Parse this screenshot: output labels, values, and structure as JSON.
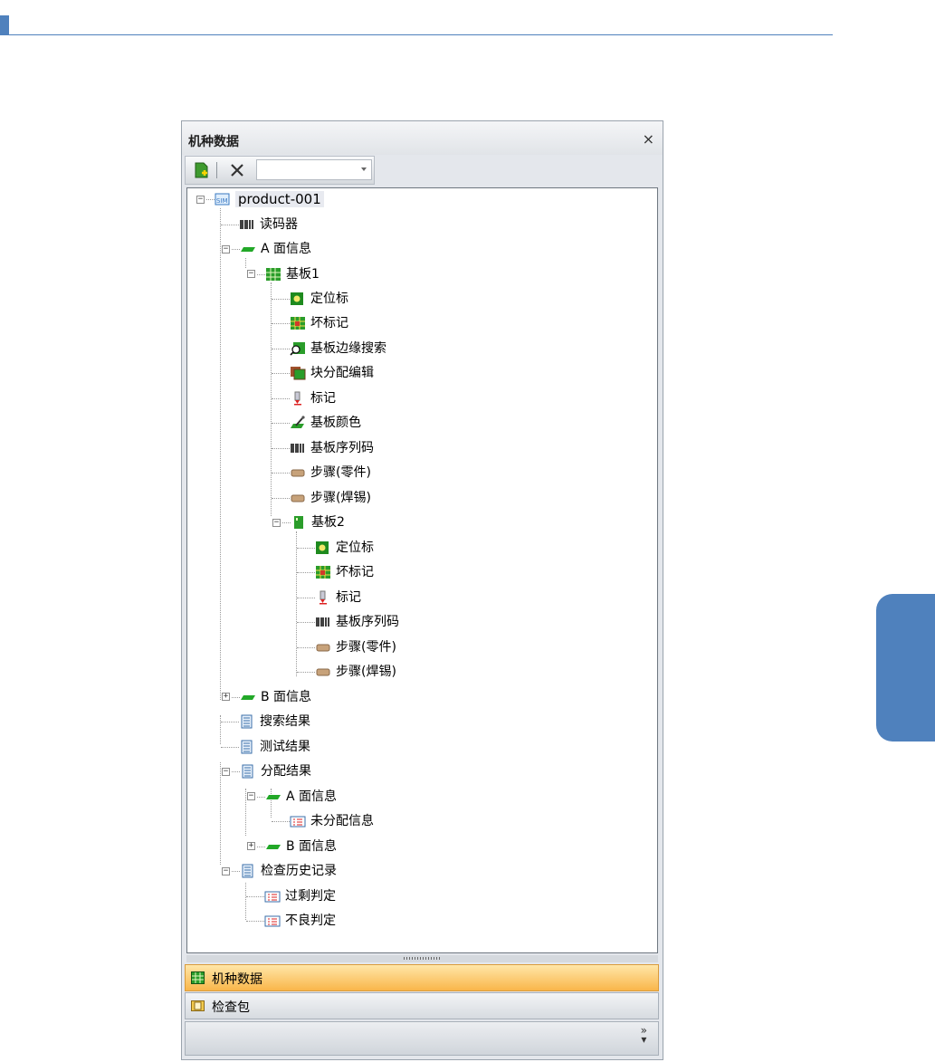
{
  "panel": {
    "title": "机种数据",
    "close_glyph": "×"
  },
  "toolbar": {
    "combo_value": ""
  },
  "tree": {
    "root": "product-001",
    "barcode_reader": "读码器",
    "side_a": "A 面信息",
    "board1": "基板1",
    "fiducial": "定位标",
    "bad_mark": "坏标记",
    "edge_search": "基板边缘搜索",
    "block_assign": "块分配编辑",
    "mark": "标记",
    "board_color": "基板颜色",
    "board_serial": "基板序列码",
    "step_component": "步骤(零件)",
    "step_solder": "步骤(焊锡)",
    "board2": "基板2",
    "side_b": "B 面信息",
    "search_result": "搜索结果",
    "test_result": "测试结果",
    "assign_result": "分配结果",
    "unassigned_info": "未分配信息",
    "inspection_history": "检查历史记录",
    "over_judgement": "过剩判定",
    "defect_judgement": "不良判定"
  },
  "nav": {
    "model_data": "机种数据",
    "inspection_package": "检查包",
    "more_glyph": "»"
  },
  "colors": {
    "accent": "#4f81bd",
    "selected_nav": "#f9b64a"
  }
}
